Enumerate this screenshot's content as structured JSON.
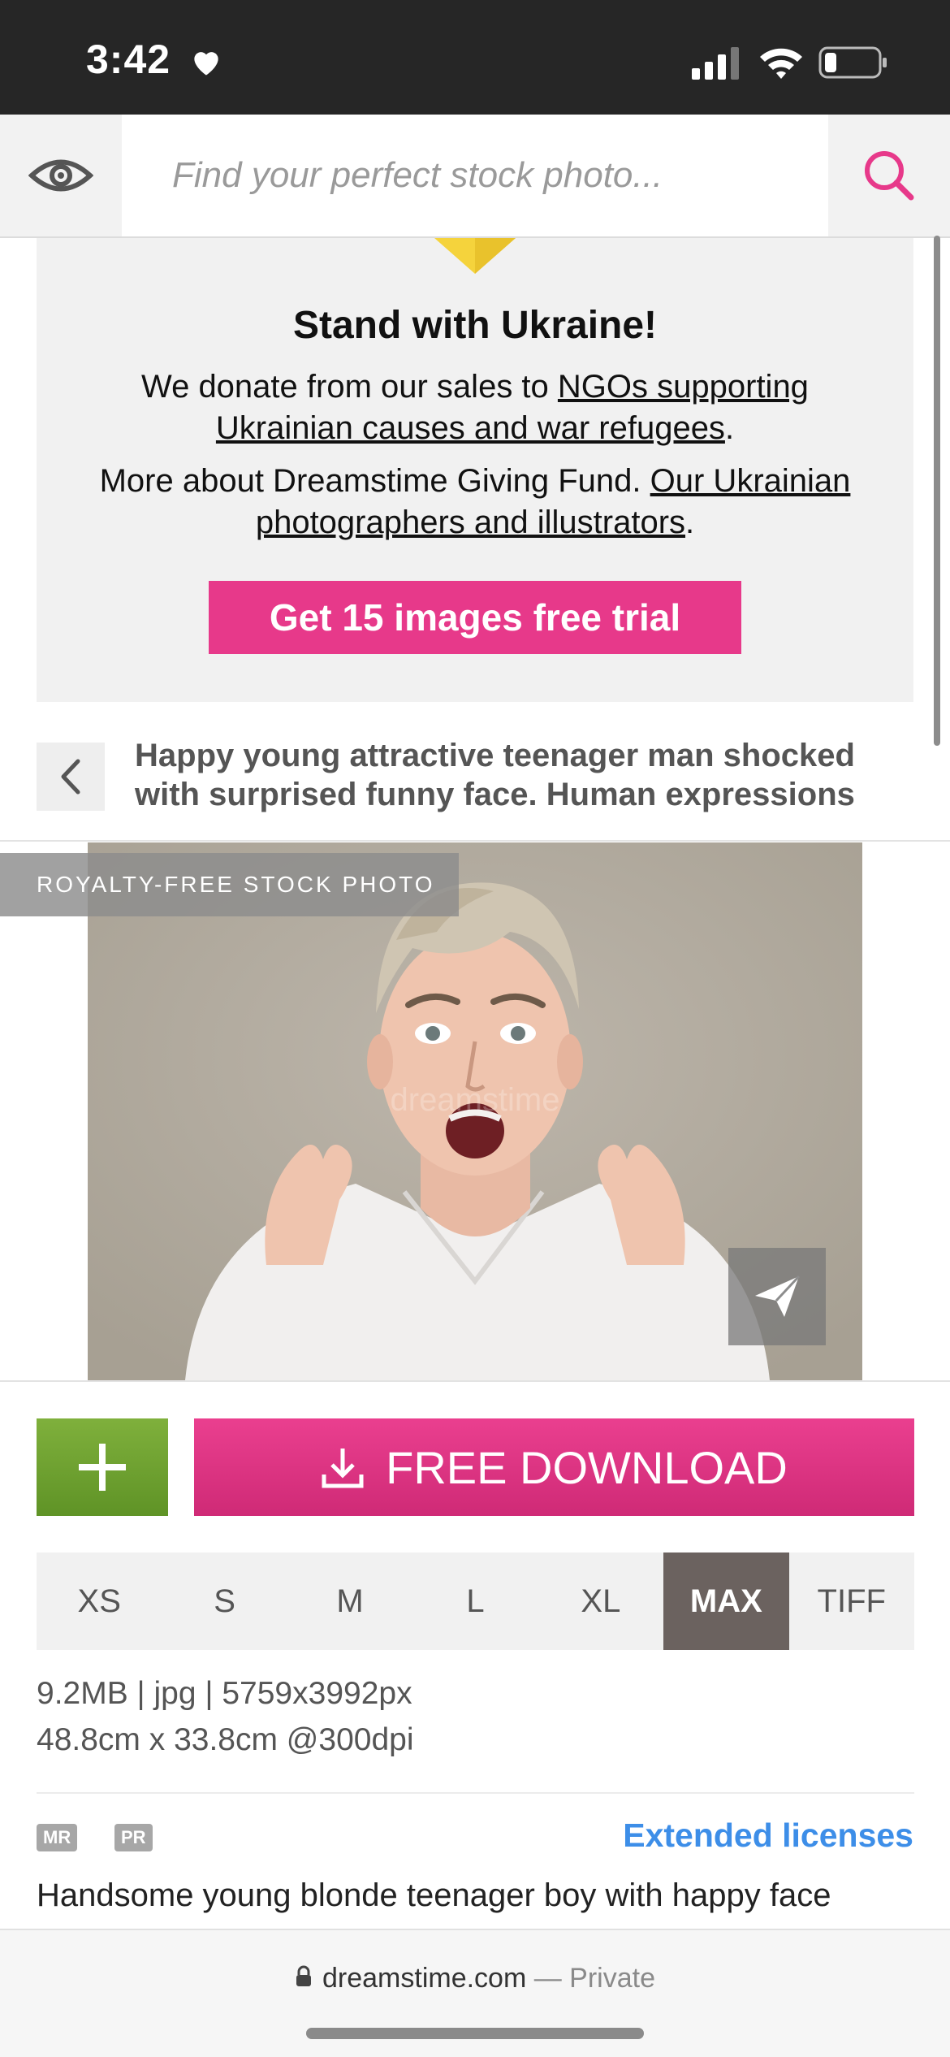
{
  "status_bar": {
    "time": "3:42"
  },
  "search": {
    "placeholder": "Find your perfect stock photo..."
  },
  "banner": {
    "title": "Stand with Ukraine!",
    "line1_prefix": "We donate from our sales to ",
    "line1_link": "NGOs supporting Ukrainian causes and war refugees",
    "line1_suffix": ".",
    "line2_prefix": "More about Dreamstime Giving Fund. ",
    "line2_link": "Our Ukrainian photographers and illustrators",
    "line2_suffix": ".",
    "cta": "Get 15 images free trial",
    "flag_color": "#f5d33c"
  },
  "image": {
    "title": "Happy young attractive teenager man shocked with surprised funny face. Human expressions",
    "label": "ROYALTY-FREE STOCK PHOTO",
    "watermark": "dreamstime"
  },
  "actions": {
    "add_label": "+",
    "download_label": "FREE DOWNLOAD"
  },
  "sizes": [
    {
      "label": "XS",
      "selected": false
    },
    {
      "label": "S",
      "selected": false
    },
    {
      "label": "M",
      "selected": false
    },
    {
      "label": "L",
      "selected": false
    },
    {
      "label": "XL",
      "selected": false
    },
    {
      "label": "MAX",
      "selected": true
    },
    {
      "label": "TIFF",
      "selected": false
    }
  ],
  "file_info": {
    "line1": "9.2MB | jpg | 5759x3992px",
    "line2": "48.8cm x 33.8cm @300dpi"
  },
  "badges": {
    "mr": "MR",
    "pr": "PR"
  },
  "extended_licenses": "Extended licenses",
  "description": "Handsome young blonde teenager boy with happy face",
  "browser": {
    "domain": "dreamstime.com",
    "mode": "— Private"
  },
  "colors": {
    "accent": "#e7398a",
    "green": "#6fa230",
    "link": "#3d8ee8",
    "selected_tab": "#6b625f"
  }
}
